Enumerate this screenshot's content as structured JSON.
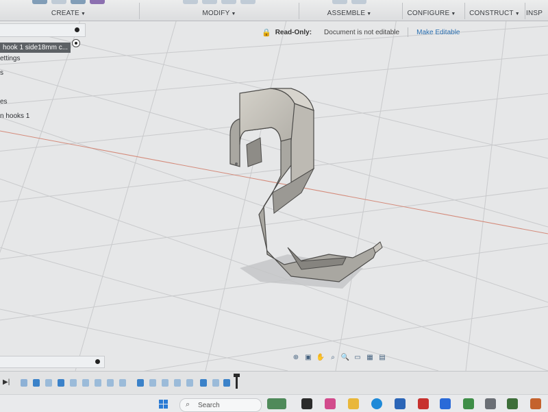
{
  "toolbar": {
    "groups": [
      {
        "label": "CREATE"
      },
      {
        "label": "MODIFY"
      },
      {
        "label": "ASSEMBLE"
      },
      {
        "label": "CONFIGURE"
      },
      {
        "label": "CONSTRUCT"
      },
      {
        "label": "INSP"
      }
    ]
  },
  "readonly": {
    "title": "Read-Only:",
    "message": "Document is not editable",
    "action": "Make Editable"
  },
  "browser": {
    "items": [
      {
        "label": "hook 1 side18mm c..."
      },
      {
        "label": "ettings"
      },
      {
        "label": "s"
      },
      {
        "label": ""
      },
      {
        "label": "es"
      },
      {
        "label": "n hooks 1"
      }
    ]
  },
  "search": {
    "label": "Search"
  },
  "colors": {
    "accent": "#2a6fb0",
    "lock": "#d08a1a",
    "selected_doc_bg": "#5d6165"
  },
  "icons": {
    "lock": "lock-icon",
    "play": "play-icon",
    "search": "search-icon",
    "windows": "windows-start-icon"
  }
}
